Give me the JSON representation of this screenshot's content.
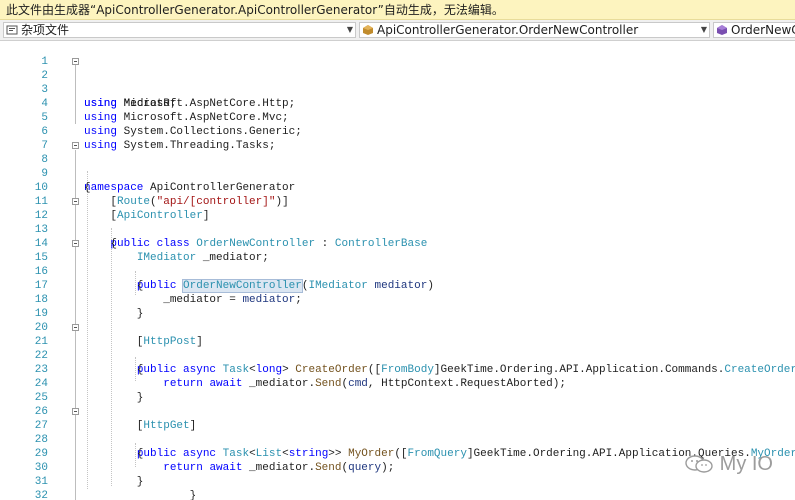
{
  "banner": {
    "text": "此文件由生成器“ApiControllerGenerator.ApiControllerGenerator”自动生成，无法编辑。"
  },
  "navbar": {
    "project": "杂项文件",
    "type": "ApiControllerGenerator.OrderNewController",
    "member": "OrderNewCo"
  },
  "colors": {
    "keyword": "#0000ff",
    "type": "#2b91af",
    "string": "#a31515",
    "line_number": "#2b91af",
    "banner_bg": "#fdf4bf"
  },
  "editor": {
    "lines": [
      {
        "n": "1",
        "text": ""
      },
      {
        "n": "2",
        "text": "using MediatR;"
      },
      {
        "n": "3",
        "text": "using Microsoft.AspNetCore.Http;"
      },
      {
        "n": "4",
        "text": "using Microsoft.AspNetCore.Mvc;"
      },
      {
        "n": "5",
        "text": "using System.Collections.Generic;"
      },
      {
        "n": "6",
        "text": "using System.Threading.Tasks;"
      },
      {
        "n": "7",
        "text": ""
      },
      {
        "n": "8",
        "text": "namespace ApiControllerGenerator"
      },
      {
        "n": "9",
        "text": "{"
      },
      {
        "n": "10",
        "text": "    [Route(\"api/[controller]\")]"
      },
      {
        "n": "11",
        "text": "    [ApiController]"
      },
      {
        "n": "12",
        "text": "    public class OrderNewController : ControllerBase"
      },
      {
        "n": "13",
        "text": "    {"
      },
      {
        "n": "14",
        "text": "        IMediator _mediator;"
      },
      {
        "n": "15",
        "text": "        public OrderNewController(IMediator mediator)"
      },
      {
        "n": "16",
        "text": "        {"
      },
      {
        "n": "17",
        "text": "            _mediator = mediator;"
      },
      {
        "n": "18",
        "text": "        }"
      },
      {
        "n": "19",
        "text": ""
      },
      {
        "n": "20",
        "text": "        [HttpPost]"
      },
      {
        "n": "21",
        "text": "        public async Task<long> CreateOrder([FromBody]GeekTime.Ordering.API.Application.Commands.CreateOrderCommand cmd)"
      },
      {
        "n": "22",
        "text": "        {"
      },
      {
        "n": "23",
        "text": "            return await _mediator.Send(cmd, HttpContext.RequestAborted);"
      },
      {
        "n": "24",
        "text": "        }"
      },
      {
        "n": "25",
        "text": ""
      },
      {
        "n": "26",
        "text": "        [HttpGet]"
      },
      {
        "n": "27",
        "text": "        public async Task<List<string>> MyOrder([FromQuery]GeekTime.Ordering.API.Application.Queries.MyOrderQuery query)"
      },
      {
        "n": "28",
        "text": "        {"
      },
      {
        "n": "29",
        "text": "            return await _mediator.Send(query);"
      },
      {
        "n": "30",
        "text": "        }"
      },
      {
        "n": "31",
        "text": "                }"
      },
      {
        "n": "32",
        "text": "}"
      }
    ]
  },
  "watermark": {
    "text": "My IO",
    "icon": "wechat-icon"
  }
}
